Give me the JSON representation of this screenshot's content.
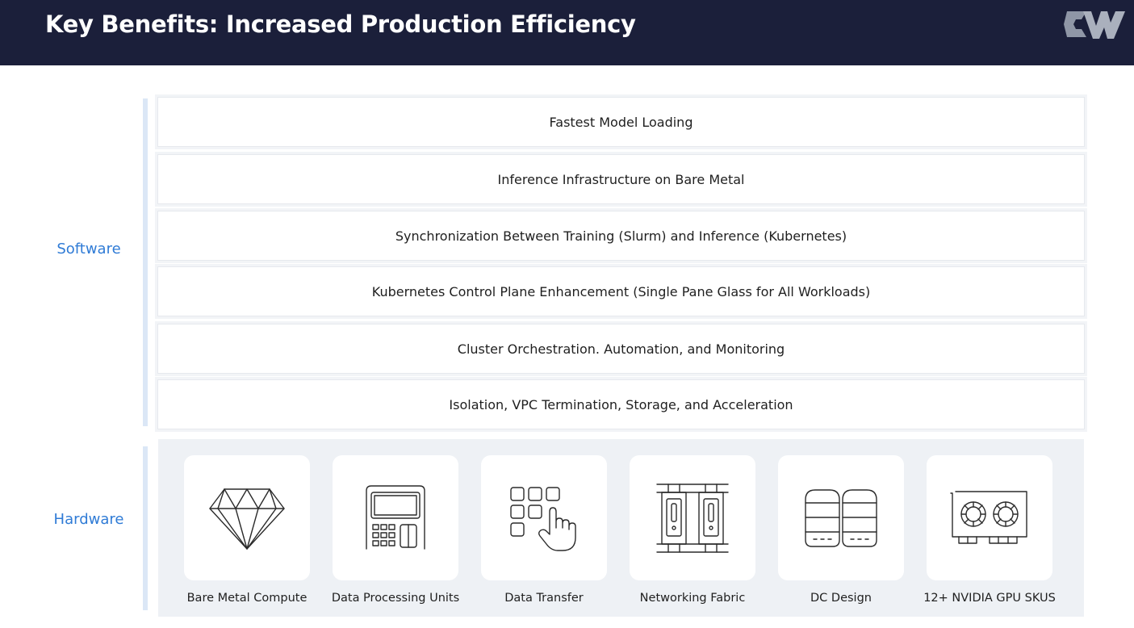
{
  "header": {
    "title": "Key Benefits: Increased Production Efficiency",
    "logo_icon": "cw-logo-icon"
  },
  "sections": {
    "software_label": "Software",
    "hardware_label": "Hardware"
  },
  "software_layers": [
    "Fastest Model Loading",
    "Inference Infrastructure on Bare Metal",
    "Synchronization Between Training (Slurm)  and Inference (Kubernetes)",
    "Kubernetes Control Plane Enhancement (Single Pane Glass for All Workloads)",
    "Cluster Orchestration. Automation, and Monitoring",
    "Isolation, VPC Termination, Storage, and Acceleration"
  ],
  "hardware_items": [
    {
      "label": "Bare Metal Compute",
      "icon": "diamond-icon"
    },
    {
      "label": "Data Processing Units",
      "icon": "dpu-icon"
    },
    {
      "label": "Data Transfer",
      "icon": "keypad-hand-icon"
    },
    {
      "label": "Networking Fabric",
      "icon": "rack-icon"
    },
    {
      "label": "DC Design",
      "icon": "server-stack-icon"
    },
    {
      "label": "12+ NVIDIA  GPU SKUS",
      "icon": "gpu-card-icon"
    }
  ],
  "colors": {
    "header_bg": "#1b1f3a",
    "accent": "#2f7bd6",
    "panel_bg": "#eef1f5"
  }
}
